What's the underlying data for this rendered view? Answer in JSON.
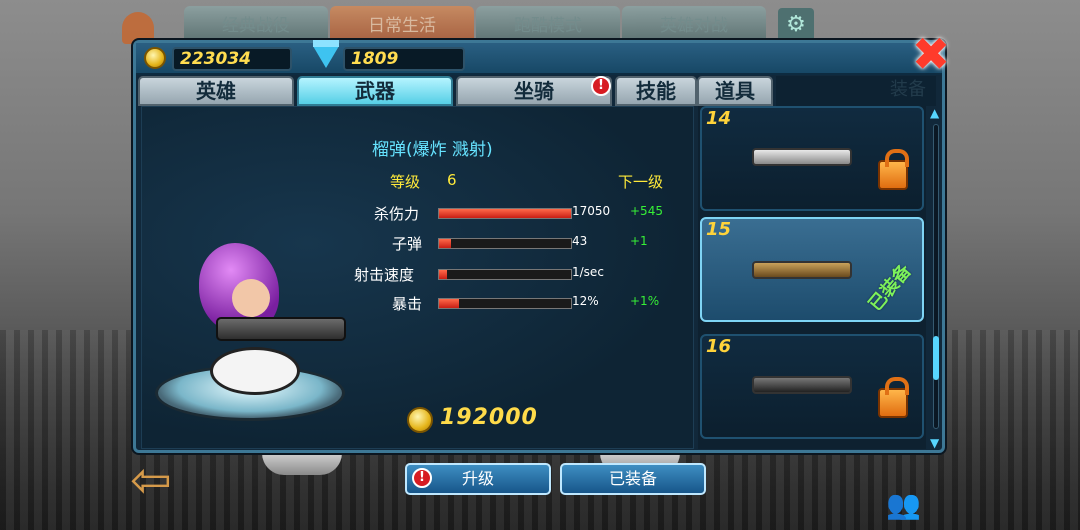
{
  "top_tabs": [
    "经典战役",
    "日常生活",
    "跑酷模式",
    "英雄对战"
  ],
  "top_active_tab": "日常生活",
  "currency": {
    "coins": "223034",
    "gems": "1809"
  },
  "tabs": [
    {
      "label": "英雄"
    },
    {
      "label": "武器"
    },
    {
      "label": "坐骑"
    },
    {
      "label": "技能"
    },
    {
      "label": "道具"
    }
  ],
  "active_tab": "武器",
  "ghost_tab_label": "装备",
  "weapon": {
    "name": "榴弹(爆炸 溅射)",
    "level_label": "等级",
    "level": "6",
    "next_label": "下一级",
    "stats": [
      {
        "label": "杀伤力",
        "value": "17050",
        "increase": "+545",
        "fill": 1.0
      },
      {
        "label": "子弹",
        "value": "43",
        "increase": "+1",
        "fill": 0.09
      },
      {
        "label": "射击速度",
        "value": "1/sec",
        "increase": "",
        "fill": 0.06
      },
      {
        "label": "暴击",
        "value": "12%",
        "increase": "+1%",
        "fill": 0.15
      }
    ],
    "price": "192000"
  },
  "buttons": {
    "upgrade": "升级",
    "equipped": "已装备"
  },
  "weapon_list": [
    {
      "num": "14",
      "locked": true,
      "equipped": false
    },
    {
      "num": "15",
      "locked": false,
      "equipped": true,
      "tag": "已装备"
    },
    {
      "num": "16",
      "locked": true,
      "equipped": false
    }
  ],
  "icons": {
    "close": "close-icon",
    "coin": "coin-icon",
    "gem": "gem-icon",
    "alert": "alert-icon",
    "lock": "lock-icon",
    "settings": "gear-icon",
    "back": "back-arrow-icon"
  },
  "alert_glyph": "!",
  "colors": {
    "accent": "#57d6ff",
    "coin": "#ffdb4a",
    "increase": "#36ef36",
    "alert": "#d71c22"
  }
}
